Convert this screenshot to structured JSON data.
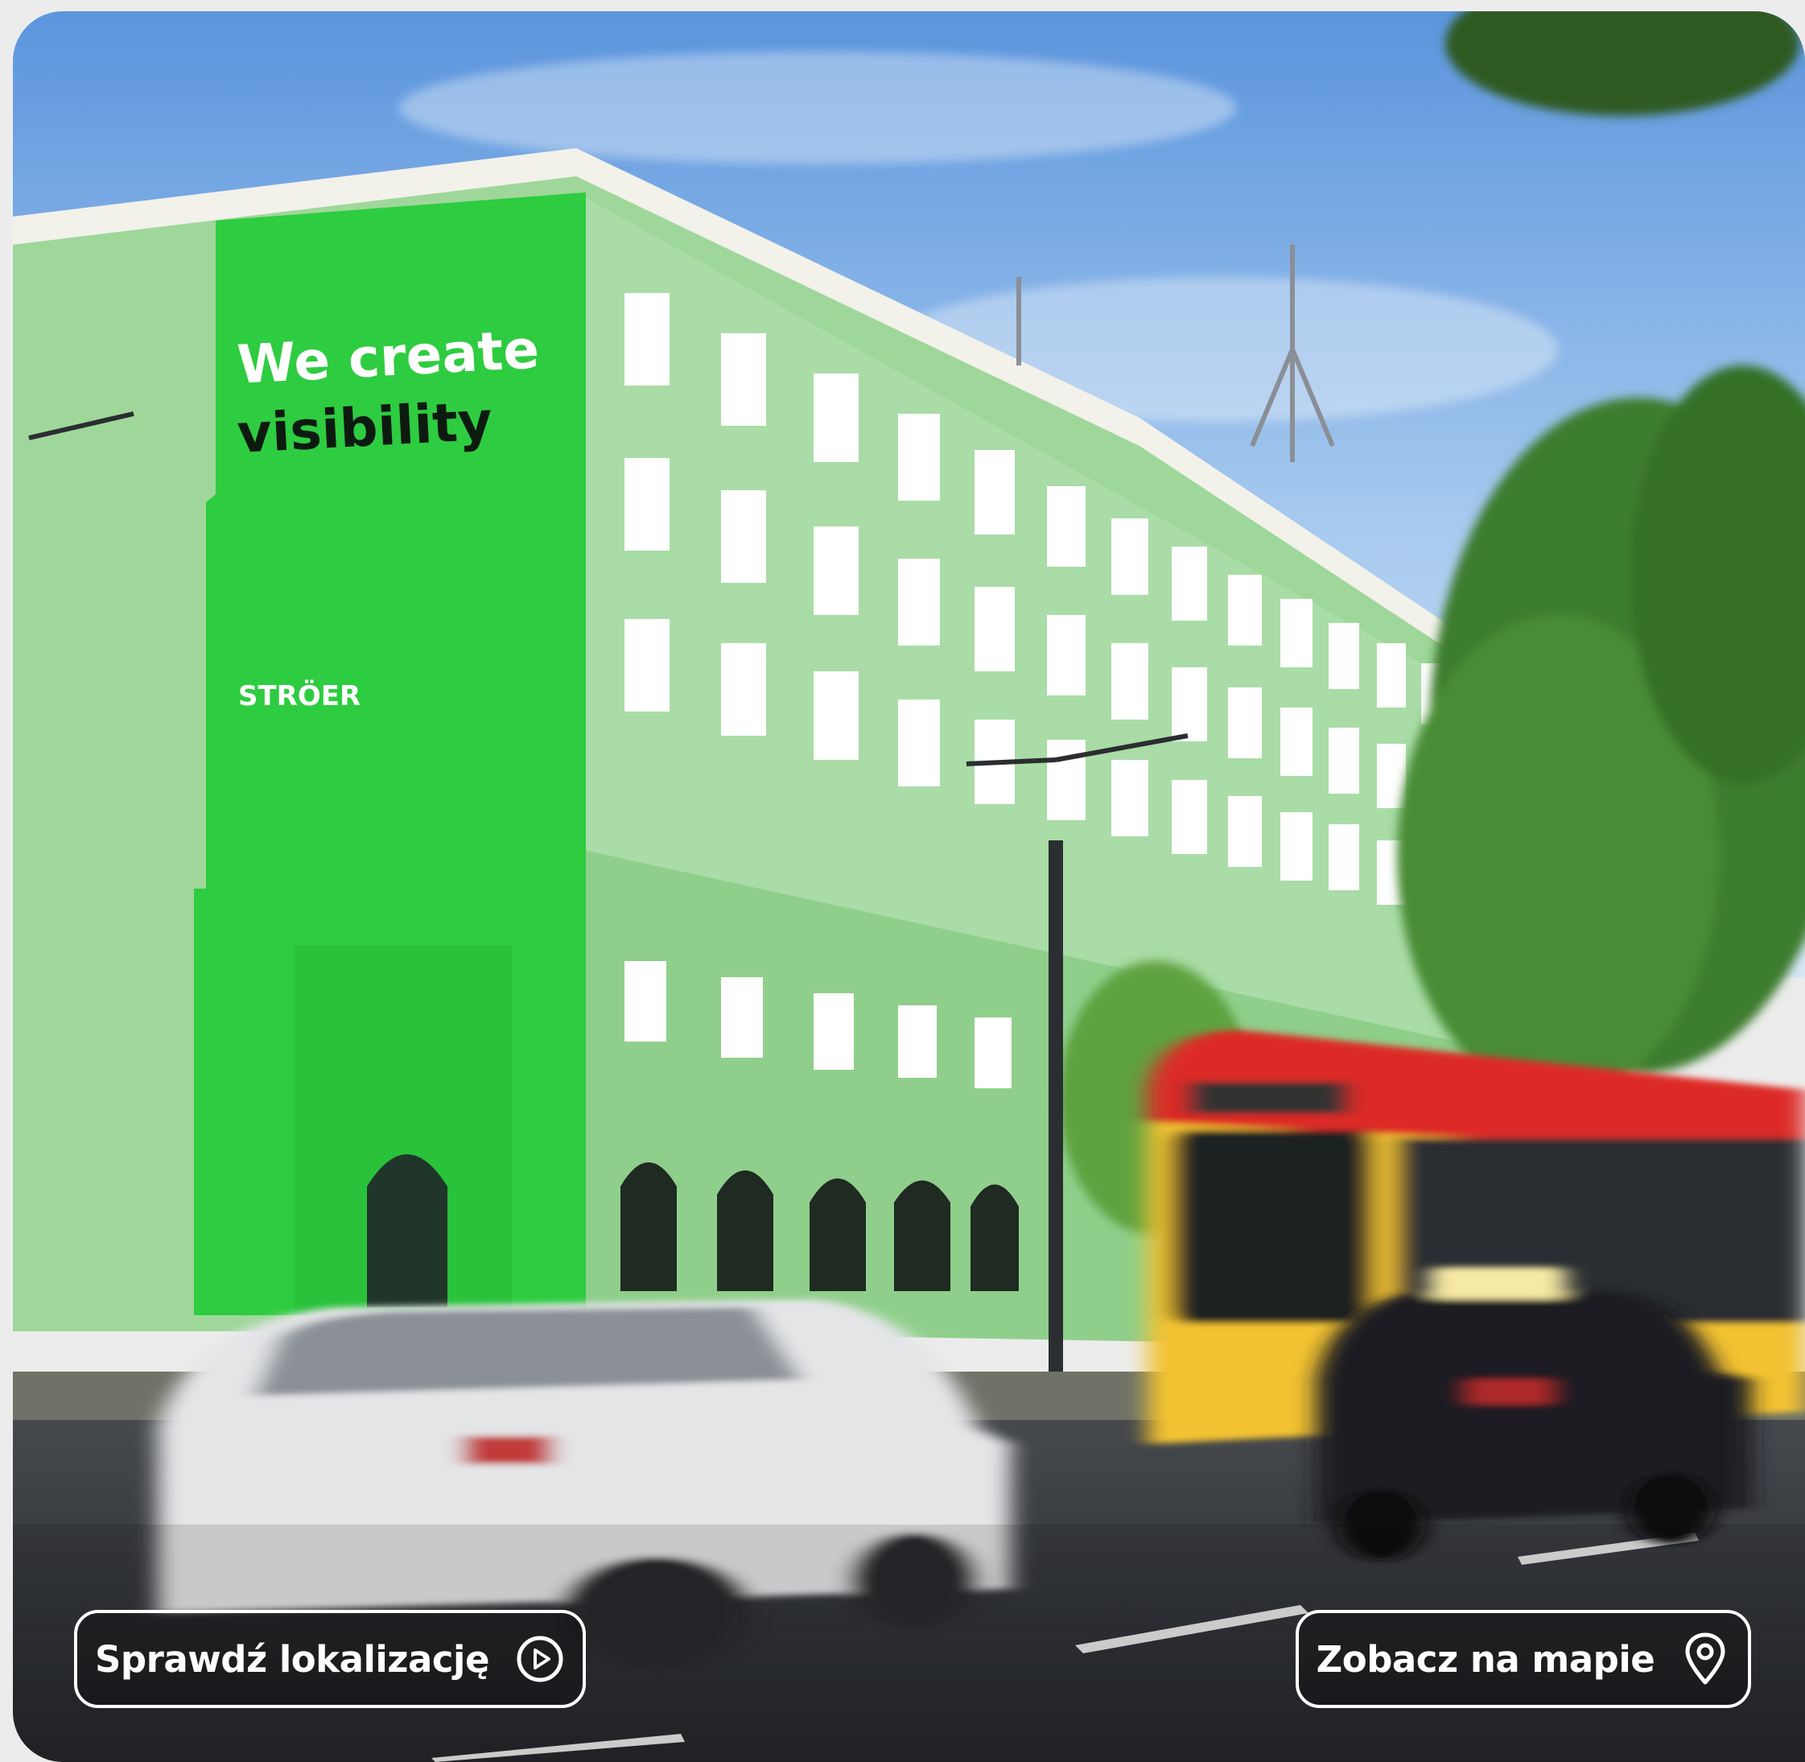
{
  "billboard": {
    "headline_line1": "We create",
    "headline_line2": "visibility",
    "brand": "STRÖER",
    "color": "#2ecc40"
  },
  "actions": {
    "check_location_label": "Sprawdź lokalizację",
    "check_location_icon": "play-circle-icon",
    "see_on_map_label": "Zobacz na mapie",
    "see_on_map_icon": "map-pin-icon"
  }
}
